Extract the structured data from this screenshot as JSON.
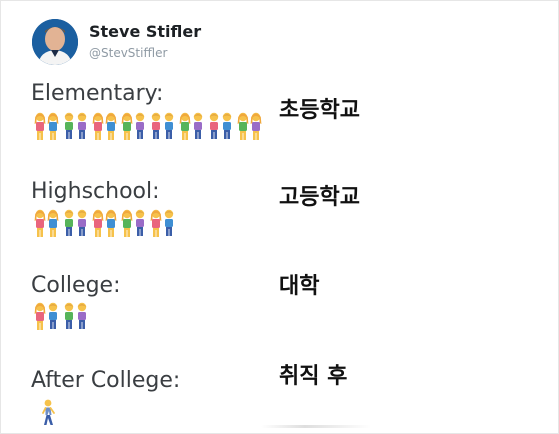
{
  "tweet": {
    "author_name": "Steve Stifler",
    "author_handle": "@StevStiffler"
  },
  "sections": [
    {
      "label": "Elementary:",
      "korean": "초등학교",
      "emoji_pairs": [
        [
          "girl",
          "girl"
        ],
        [
          "boy",
          "boy"
        ],
        [
          "girl",
          "girl"
        ],
        [
          "girl",
          "boy"
        ],
        [
          "boy",
          "boy"
        ],
        [
          "girl",
          "boy"
        ],
        [
          "boy",
          "boy"
        ],
        [
          "girl",
          "girl"
        ]
      ]
    },
    {
      "label": "Highschool:",
      "korean": "고등학교",
      "emoji_pairs": [
        [
          "girl",
          "girl"
        ],
        [
          "boy",
          "boy"
        ],
        [
          "girl",
          "girl"
        ],
        [
          "girl",
          "boy"
        ],
        [
          "girl",
          "boy"
        ]
      ]
    },
    {
      "label": "College:",
      "korean": "대학",
      "emoji_pairs": [
        [
          "girl",
          "boy"
        ],
        [
          "boy",
          "boy"
        ]
      ]
    },
    {
      "label": "After College:",
      "korean": "취직 후",
      "emoji_pairs": []
    }
  ],
  "after_college_emoji": "walking-man-icon",
  "colors": {
    "name_text": "#1c2024",
    "handle_text": "#8f9aa4",
    "label_text": "#3a3e42",
    "korean_text": "#111111",
    "skin": "#f6c24b",
    "hair_girl": "#f0a83c",
    "shirt_colors": [
      "#e9657d",
      "#3f8fd3",
      "#57b45a",
      "#9a6cc7"
    ],
    "pants": "#3b5ea8"
  }
}
